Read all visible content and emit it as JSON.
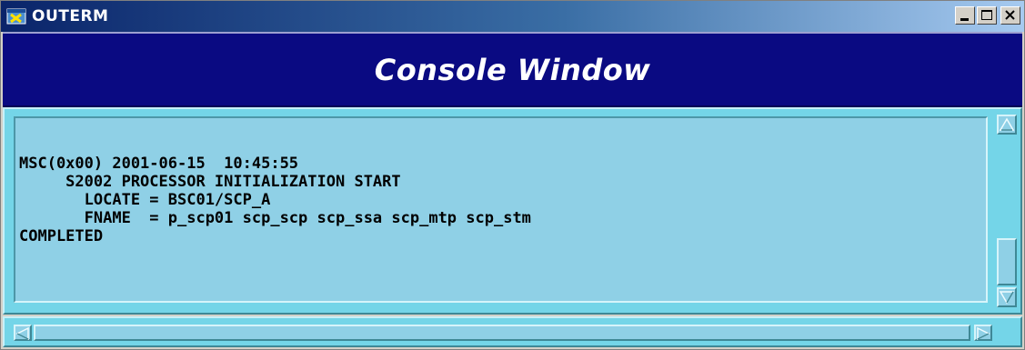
{
  "window": {
    "title": "OUTERM",
    "app_icon": "outerm-app-icon",
    "controls": [
      "minimize-icon",
      "maximize-icon",
      "close-icon"
    ]
  },
  "header": {
    "title": "Console Window"
  },
  "console": {
    "lines": [
      "MSC(0x00) 2001-06-15  10:45:55",
      "     S2002 PROCESSOR INITIALIZATION START",
      "       LOCATE = BSC01/SCP_A",
      "       FNAME  = p_scp01 scp_scp scp_ssa scp_mtp scp_stm",
      "COMPLETED"
    ]
  },
  "colors": {
    "header_bg": "#0a0a82",
    "console_bg": "#8fd0e6",
    "frame_bg": "#74d5e8",
    "titlebar_start": "#0a246a",
    "titlebar_end": "#a6caf0"
  }
}
